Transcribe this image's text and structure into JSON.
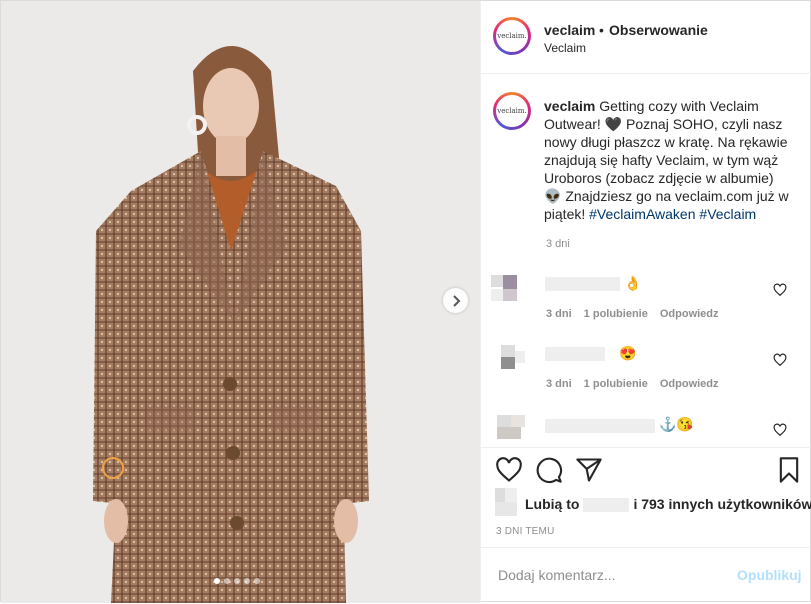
{
  "header": {
    "username": "veclaim",
    "separator": "•",
    "follow_label": "Obserwowanie",
    "subtitle": "Veclaim",
    "avatar_text": "veclaim."
  },
  "caption": {
    "username": "veclaim",
    "text_1": " Getting cozy with Veclaim Outwear! 🖤 Poznaj SOHO, czyli nasz nowy długi płaszcz w kratę. Na rękawie znajdują się hafty Veclaim, w tym wąż Uroboros (zobacz zdjęcie w albumie)👽 Znajdziesz go na veclaim.com już w piątek! ",
    "tag_1": "#VeclaimAwaken",
    "tag_2": "#Veclaim",
    "time": "3 dni"
  },
  "comments": [
    {
      "emoji": "👌",
      "time": "3 dni",
      "likes": "1 polubienie",
      "reply": "Odpowiedz"
    },
    {
      "emoji": "😍",
      "time": "3 dni",
      "likes": "1 polubienie",
      "reply": "Odpowiedz"
    },
    {
      "emoji": "⚓😘",
      "time": "",
      "likes": "",
      "reply": ""
    }
  ],
  "likes": {
    "prefix": "Lubią to",
    "suffix": "i 793 innych użytkowników"
  },
  "date": "3 DNI TEMU",
  "add_comment": {
    "placeholder": "Dodaj komentarz...",
    "publish": "Opublikuj"
  },
  "carousel": {
    "slides": 5,
    "active": 0
  },
  "icons": {
    "next": "chevron-right-icon",
    "like": "heart-icon",
    "comment": "comment-icon",
    "share": "paper-plane-icon",
    "save": "bookmark-icon"
  },
  "colors": {
    "link": "#00376b",
    "muted": "#8e8e8e",
    "publish": "#b2dffc",
    "coat": "#9b6e52"
  }
}
